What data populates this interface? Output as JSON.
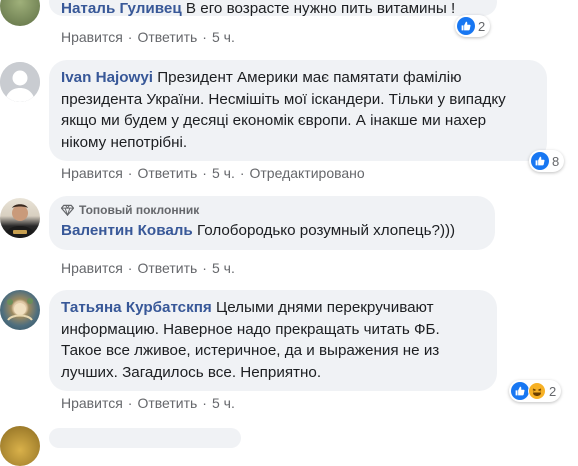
{
  "comments": [
    {
      "author": "Наталь Гуливец",
      "text": "В его возрасте нужно пить витамины !",
      "actions": [
        "Нравится",
        "Ответить",
        "5 ч."
      ],
      "reaction_count": "2"
    },
    {
      "author": "Ivan Hajowyi",
      "text": "Президент Америки має памятати фамілію президента України. Несмішіть мої іскандери. Тільки у випадку якщо ми будем у десяці економік європи. А інакше ми нахер нікому непотрібні.",
      "actions": [
        "Нравится",
        "Ответить",
        "5 ч.",
        "Отредактировано"
      ],
      "reaction_count": "8"
    },
    {
      "badge": "Топовый поклонник",
      "author": "Валентин Коваль",
      "text": "Голобородько розумный хлопець?)))",
      "actions": [
        "Нравится",
        "Ответить",
        "5 ч."
      ]
    },
    {
      "author": "Татьяна Курбатскпя",
      "text": "Целыми днями перекручивают информацию. Наверное надо прекращать читать ФБ. Такое все лживое, истеричное, да и выражения не из лучших. Загадилось все. Неприятно.",
      "actions": [
        "Нравится",
        "Ответить",
        "5 ч."
      ],
      "reaction_count": "2"
    }
  ],
  "colors": {
    "author": "#385898",
    "bubble": "#f0f2f5",
    "meta": "#65676b",
    "like": "#1877f2"
  }
}
